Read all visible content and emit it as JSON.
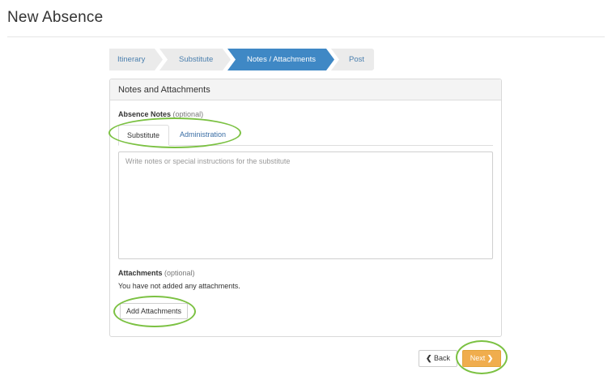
{
  "page": {
    "title": "New Absence"
  },
  "steps": [
    {
      "label": "Itinerary",
      "state": "done"
    },
    {
      "label": "Substitute",
      "state": "done"
    },
    {
      "label": "Notes / Attachments",
      "state": "active"
    },
    {
      "label": "Post",
      "state": "todo"
    }
  ],
  "panel": {
    "title": "Notes and Attachments",
    "notes": {
      "label": "Absence Notes",
      "optional": "(optional)",
      "tabs": [
        {
          "label": "Substitute",
          "active": true
        },
        {
          "label": "Administration",
          "active": false
        }
      ],
      "value": "",
      "placeholder": "Write notes or special instructions for the substitute"
    },
    "attachments": {
      "label": "Attachments",
      "optional": "(optional)",
      "empty_text": "You have not added any attachments.",
      "add_label": "Add Attachments"
    }
  },
  "footer": {
    "back_icon": "chevron-left-icon",
    "back_label": "Back",
    "next_label": "Next",
    "next_icon": "chevron-right-icon"
  },
  "colors": {
    "step_active": "#3f88c5",
    "step_inactive": "#ebebeb",
    "next_button": "#f0ad4e",
    "highlight": "#7bc142",
    "link": "#3a6ea5"
  }
}
